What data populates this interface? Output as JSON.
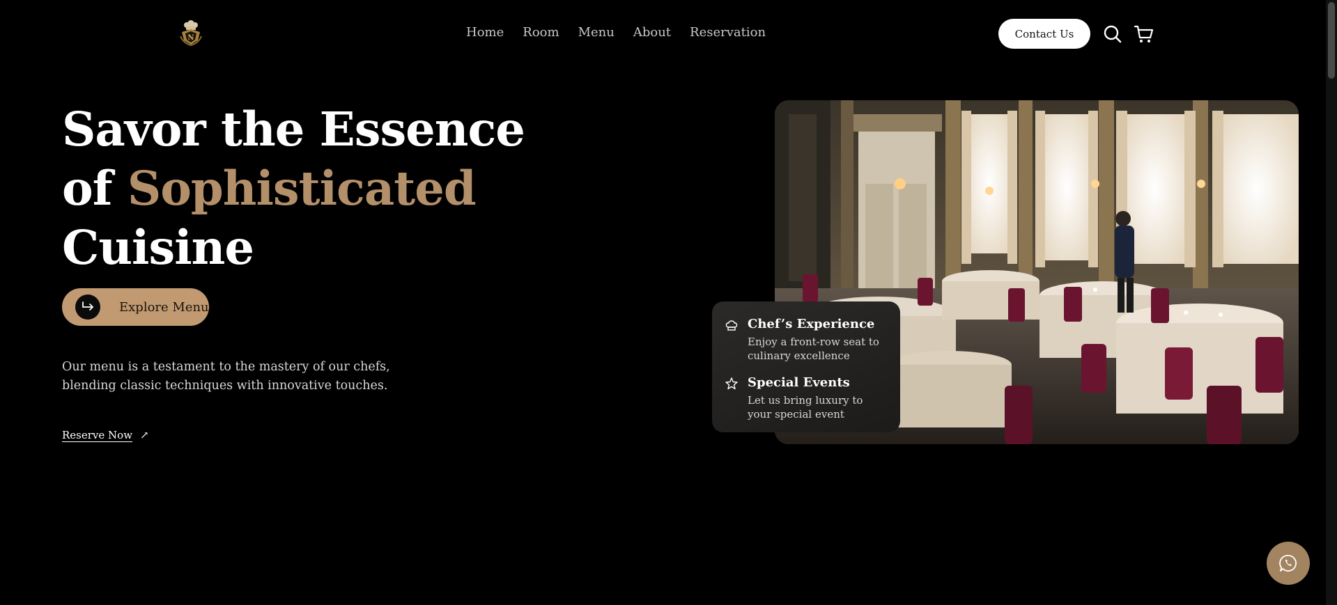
{
  "nav": {
    "logo_icon": "chef-crest-logo",
    "links": [
      "Home",
      "Room",
      "Menu",
      "About",
      "Reservation"
    ],
    "contact_label": "Contact Us",
    "search_icon": "search-icon",
    "cart_icon": "cart-icon"
  },
  "hero": {
    "title_line1": "Savor the Essence",
    "title_of": "of",
    "title_accent": "Sophisticated",
    "title_line3": "Cuisine",
    "explore_label": "Explore Menu",
    "explore_icon": "return-arrow-icon",
    "description": "Our menu is a testament to the mastery of our chefs, blending classic techniques with innovative touches.",
    "reserve_label": "Reserve Now",
    "reserve_icon": "↗"
  },
  "features": [
    {
      "icon": "chef-hat-icon",
      "title": "Chef’s Experience",
      "description": "Enjoy a front-row seat to culinary excellence"
    },
    {
      "icon": "star-icon",
      "title": "Special Events",
      "description": "Let us bring luxury to your special event"
    }
  ],
  "chat_icon": "whatsapp-icon",
  "colors": {
    "background": "#000000",
    "accent": "#b39069",
    "button": "#c19a72",
    "fab": "#a28461"
  }
}
